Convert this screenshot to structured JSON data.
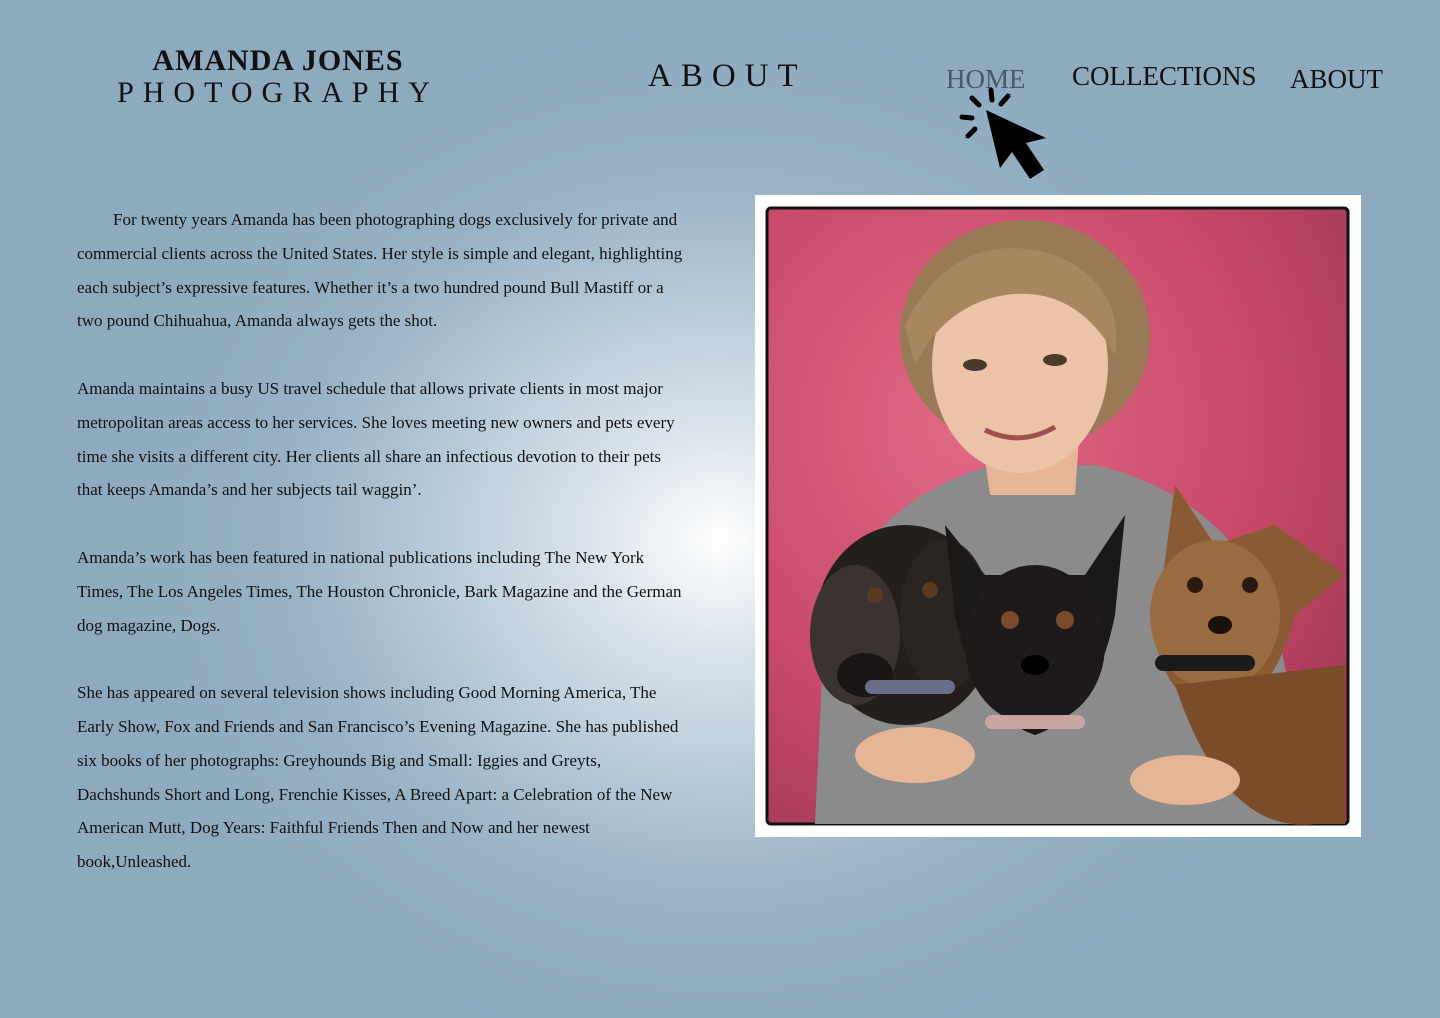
{
  "logo": {
    "name": "AMANDA JONES",
    "subtitle": "PHOTOGRAPHY"
  },
  "page_heading": "ABOUT",
  "nav": {
    "home": "HOME",
    "collections": "COLLECTIONS",
    "about": "ABOUT"
  },
  "bio": [
    "For twenty years Amanda has been photographing dogs exclusively for private and commercial clients across the United States. Her style is simple and elegant, highlighting each subject’s expressive features. Whether it’s a two hundred pound Bull Mastiff or a two pound Chihuahua, Amanda always gets the shot.",
    "Amanda maintains a busy US travel schedule that allows private clients in most major metropolitan areas access to her services. She loves meeting new owners and pets every time she visits a different city. Her clients all share an infectious devotion to their pets that keeps Amanda’s and her subjects tail waggin’.",
    "Amanda’s work has been featured in national publications including The New York Times, The Los Angeles Times, The Houston Chronicle, Bark Magazine and the German dog magazine, Dogs.",
    "She has appeared on several television shows including Good Morning America, The Early Show, Fox and Friends and San Francisco’s Evening Magazine. She has published six books of her photographs: Greyhounds Big and Small: Iggies and Greyts, Dachshunds Short and Long, Frenchie Kisses, A Breed Apart: a Celebration of the New American Mutt, Dog Years: Faithful Friends Then and Now and her newest book,Unleashed."
  ],
  "icons": {
    "cursor": "click-pointer-icon"
  },
  "colors": {
    "background": "#8eaabf",
    "nav_active": "#48596a",
    "photo_backdrop": "#c94a6a"
  }
}
